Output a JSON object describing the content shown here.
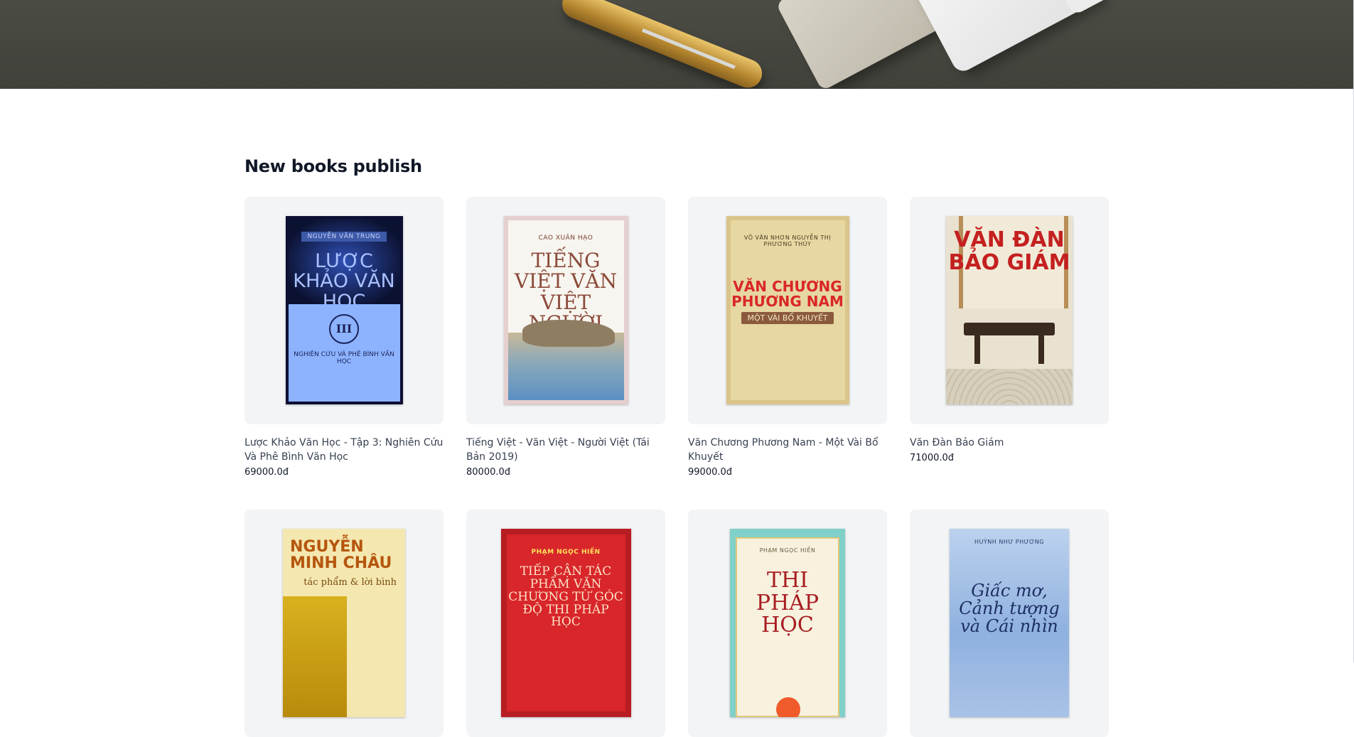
{
  "section": {
    "title": "New books publish"
  },
  "books": [
    {
      "title": "Lược Khảo Văn Học - Tập 3: Nghiên Cứu Và Phê Bình Văn Học",
      "price": "69000.0đ",
      "cover": {
        "author": "NGUYỄN VĂN TRUNG",
        "title": "LƯỢC KHẢO VĂN HỌC",
        "volume": "III",
        "subtitle": "NGHIÊN CỨU VÀ PHÊ BÌNH VĂN HỌC"
      }
    },
    {
      "title": "Tiếng Việt - Văn Việt - Người Việt (Tái Bản 2019)",
      "price": "80000.0đ",
      "cover": {
        "author": "CAO XUÂN HẠO",
        "title": "TIẾNG VIỆT VĂN VIỆT NGƯỜI VIỆT"
      }
    },
    {
      "title": "Văn Chương Phương Nam - Một Vài Bổ Khuyết",
      "price": "99000.0đ",
      "cover": {
        "author": "VÕ VĂN NHƠN NGUYỄN THỊ PHƯƠNG THÚY",
        "title": "VĂN CHƯƠNG PHƯƠNG NAM",
        "band": "MỘT VÀI BỔ KHUYẾT"
      }
    },
    {
      "title": "Văn Đàn Bảo Giám",
      "price": "71000.0đ",
      "cover": {
        "title": "VĂN ĐÀN BẢO GIÁM"
      }
    },
    {
      "cover": {
        "title": "NGUYỄN MINH CHÂU",
        "subtitle": "tác phẩm & lời bình"
      }
    },
    {
      "cover": {
        "author": "PHẠM NGỌC HIỀN",
        "title": "TIẾP CẬN TÁC PHẨM VĂN CHƯƠNG TỪ GÓC ĐỘ THI PHÁP HỌC"
      }
    },
    {
      "cover": {
        "author": "PHẠM NGỌC HIỀN",
        "title": "THI PHÁP HỌC"
      }
    },
    {
      "cover": {
        "author": "HUỲNH NHƯ PHƯƠNG",
        "title": "Giấc mơ, Cảnh tượng và Cái nhìn"
      }
    }
  ]
}
